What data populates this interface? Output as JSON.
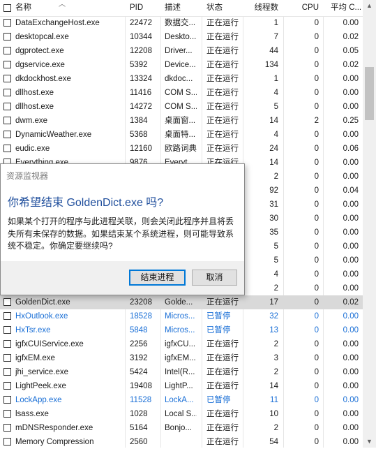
{
  "columns": {
    "name": "名称",
    "pid": "PID",
    "desc": "描述",
    "status": "状态",
    "threads": "线程数",
    "cpu": "CPU",
    "avg": "平均 C..."
  },
  "rows": [
    {
      "name": "DataExchangeHost.exe",
      "pid": "22472",
      "desc": "数据交...",
      "status": "正在运行",
      "threads": "1",
      "cpu": "0",
      "avg": "0.00"
    },
    {
      "name": "desktopcal.exe",
      "pid": "10344",
      "desc": "Deskto...",
      "status": "正在运行",
      "threads": "7",
      "cpu": "0",
      "avg": "0.02"
    },
    {
      "name": "dgprotect.exe",
      "pid": "12208",
      "desc": "Driver...",
      "status": "正在运行",
      "threads": "44",
      "cpu": "0",
      "avg": "0.05"
    },
    {
      "name": "dgservice.exe",
      "pid": "5392",
      "desc": "Device...",
      "status": "正在运行",
      "threads": "134",
      "cpu": "0",
      "avg": "0.02"
    },
    {
      "name": "dkdockhost.exe",
      "pid": "13324",
      "desc": "dkdoc...",
      "status": "正在运行",
      "threads": "1",
      "cpu": "0",
      "avg": "0.00"
    },
    {
      "name": "dllhost.exe",
      "pid": "11416",
      "desc": "COM S...",
      "status": "正在运行",
      "threads": "4",
      "cpu": "0",
      "avg": "0.00"
    },
    {
      "name": "dllhost.exe",
      "pid": "14272",
      "desc": "COM S...",
      "status": "正在运行",
      "threads": "5",
      "cpu": "0",
      "avg": "0.00"
    },
    {
      "name": "dwm.exe",
      "pid": "1384",
      "desc": "桌面窗...",
      "status": "正在运行",
      "threads": "14",
      "cpu": "2",
      "avg": "0.25"
    },
    {
      "name": "DynamicWeather.exe",
      "pid": "5368",
      "desc": "桌面特...",
      "status": "正在运行",
      "threads": "4",
      "cpu": "0",
      "avg": "0.00"
    },
    {
      "name": "eudic.exe",
      "pid": "12160",
      "desc": "欧路词典",
      "status": "正在运行",
      "threads": "24",
      "cpu": "0",
      "avg": "0.06"
    },
    {
      "name": "Everything.exe",
      "pid": "9876",
      "desc": "Everyt...",
      "status": "正在运行",
      "threads": "14",
      "cpu": "0",
      "avg": "0.00"
    },
    {
      "name": "",
      "pid": "",
      "desc": "",
      "status": "",
      "threads": "2",
      "cpu": "0",
      "avg": "0.00"
    },
    {
      "name": "",
      "pid": "",
      "desc": "",
      "status": "",
      "threads": "92",
      "cpu": "0",
      "avg": "0.04"
    },
    {
      "name": "",
      "pid": "",
      "desc": "",
      "status": "",
      "threads": "31",
      "cpu": "0",
      "avg": "0.00"
    },
    {
      "name": "",
      "pid": "",
      "desc": "",
      "status": "",
      "threads": "30",
      "cpu": "0",
      "avg": "0.00"
    },
    {
      "name": "",
      "pid": "",
      "desc": "",
      "status": "",
      "threads": "35",
      "cpu": "0",
      "avg": "0.00"
    },
    {
      "name": "",
      "pid": "",
      "desc": "",
      "status": "",
      "threads": "5",
      "cpu": "0",
      "avg": "0.00"
    },
    {
      "name": "",
      "pid": "",
      "desc": "",
      "status": "",
      "threads": "5",
      "cpu": "0",
      "avg": "0.00"
    },
    {
      "name": "",
      "pid": "",
      "desc": "",
      "status": "",
      "threads": "4",
      "cpu": "0",
      "avg": "0.00"
    },
    {
      "name": "",
      "pid": "",
      "desc": "",
      "status": "",
      "threads": "2",
      "cpu": "0",
      "avg": "0.00"
    },
    {
      "name": "GoldenDict.exe",
      "pid": "23208",
      "desc": "Golde...",
      "status": "正在运行",
      "threads": "17",
      "cpu": "0",
      "avg": "0.02",
      "selected": true
    },
    {
      "name": "HxOutlook.exe",
      "pid": "18528",
      "desc": "Micros...",
      "status": "已暂停",
      "threads": "32",
      "cpu": "0",
      "avg": "0.00",
      "suspended": true
    },
    {
      "name": "HxTsr.exe",
      "pid": "5848",
      "desc": "Micros...",
      "status": "已暂停",
      "threads": "13",
      "cpu": "0",
      "avg": "0.00",
      "suspended": true
    },
    {
      "name": "igfxCUIService.exe",
      "pid": "2256",
      "desc": "igfxCU...",
      "status": "正在运行",
      "threads": "2",
      "cpu": "0",
      "avg": "0.00"
    },
    {
      "name": "igfxEM.exe",
      "pid": "3192",
      "desc": "igfxEM...",
      "status": "正在运行",
      "threads": "3",
      "cpu": "0",
      "avg": "0.00"
    },
    {
      "name": "jhi_service.exe",
      "pid": "5424",
      "desc": "Intel(R...",
      "status": "正在运行",
      "threads": "2",
      "cpu": "0",
      "avg": "0.00"
    },
    {
      "name": "LightPeek.exe",
      "pid": "19408",
      "desc": "LightP...",
      "status": "正在运行",
      "threads": "14",
      "cpu": "0",
      "avg": "0.00"
    },
    {
      "name": "LockApp.exe",
      "pid": "11528",
      "desc": "LockA...",
      "status": "已暂停",
      "threads": "11",
      "cpu": "0",
      "avg": "0.00",
      "suspended": true
    },
    {
      "name": "lsass.exe",
      "pid": "1028",
      "desc": "Local S...",
      "status": "正在运行",
      "threads": "10",
      "cpu": "0",
      "avg": "0.00"
    },
    {
      "name": "mDNSResponder.exe",
      "pid": "5164",
      "desc": "Bonjo...",
      "status": "正在运行",
      "threads": "2",
      "cpu": "0",
      "avg": "0.00"
    },
    {
      "name": "Memory Compression",
      "pid": "2560",
      "desc": "",
      "status": "正在运行",
      "threads": "54",
      "cpu": "0",
      "avg": "0.00"
    }
  ],
  "dialog": {
    "title": "资源监视器",
    "heading": "你希望结束 GoldenDict.exe 吗?",
    "body": "如果某个打开的程序与此进程关联，则会关闭此程序并且将丢失所有未保存的数据。如果结束某个系统进程，则可能导致系统不稳定。你确定要继续吗?",
    "end_button": "结束进程",
    "cancel_button": "取消"
  },
  "colors": {
    "suspended_text": "#1a6fd6",
    "selected_row": "#d9d9d9",
    "dialog_heading": "#1f4e9c",
    "primary_border": "#0078d7"
  }
}
